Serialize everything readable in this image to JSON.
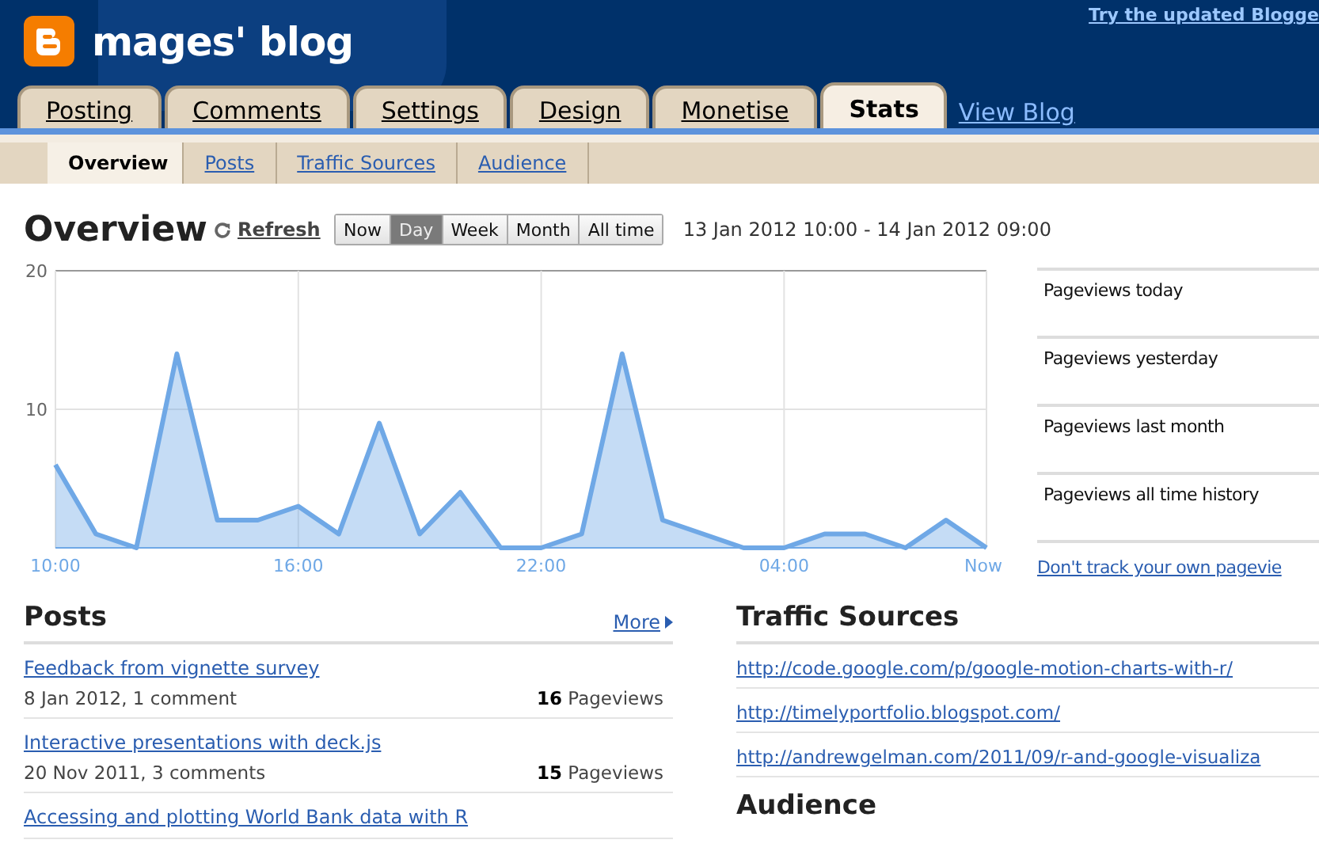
{
  "header": {
    "blog_title": "mages' blog",
    "top_link": "Try the updated Blogge"
  },
  "tabs": [
    {
      "label": "Posting",
      "selected": false
    },
    {
      "label": "Comments",
      "selected": false
    },
    {
      "label": "Settings",
      "selected": false
    },
    {
      "label": "Design",
      "selected": false
    },
    {
      "label": "Monetise",
      "selected": false
    },
    {
      "label": "Stats",
      "selected": true
    }
  ],
  "view_blog_link": "View Blog",
  "subtabs": [
    {
      "label": "Overview",
      "selected": true
    },
    {
      "label": "Posts",
      "selected": false
    },
    {
      "label": "Traffic Sources",
      "selected": false
    },
    {
      "label": "Audience",
      "selected": false
    }
  ],
  "overview": {
    "title": "Overview",
    "refresh": "Refresh",
    "ranges": [
      {
        "label": "Now",
        "selected": false
      },
      {
        "label": "Day",
        "selected": true
      },
      {
        "label": "Week",
        "selected": false
      },
      {
        "label": "Month",
        "selected": false
      },
      {
        "label": "All time",
        "selected": false
      }
    ],
    "date_range": "13 Jan 2012 10:00 - 14 Jan 2012 09:00",
    "chart_data": {
      "type": "area",
      "categories": [
        "10:00",
        null,
        null,
        null,
        null,
        null,
        "16:00",
        null,
        null,
        null,
        null,
        null,
        "22:00",
        null,
        null,
        null,
        null,
        null,
        "04:00",
        null,
        null,
        null,
        null,
        "Now"
      ],
      "series": [
        {
          "color": "#6fa8e6",
          "values": [
            6,
            1,
            0,
            14,
            2,
            2,
            3,
            1,
            9,
            1,
            4,
            0,
            0,
            1,
            14,
            2,
            1,
            0,
            0,
            1,
            1,
            0,
            2,
            0
          ]
        }
      ],
      "ylim": [
        0,
        20
      ],
      "grid": true,
      "yticks": [
        10,
        20
      ]
    }
  },
  "stats": [
    "Pageviews today",
    "Pageviews yesterday",
    "Pageviews last month",
    "Pageviews all time history"
  ],
  "dont_track_link": "Don't track your own pagevie",
  "posts": {
    "title": "Posts",
    "more": "More",
    "items": [
      {
        "title": "Feedback from vignette survey",
        "meta": "8 Jan 2012, 1 comment",
        "count": "16",
        "unit": "Pageviews"
      },
      {
        "title": "Interactive presentations with deck.js",
        "meta": "20 Nov 2011, 3 comments",
        "count": "15",
        "unit": "Pageviews"
      },
      {
        "title": "Accessing and plotting World Bank data with R"
      }
    ]
  },
  "traffic_sources": {
    "title": "Traffic Sources",
    "links": [
      "http://code.google.com/p/google-motion-charts-with-r/",
      "http://timelyportfolio.blogspot.com/",
      "http://andrewgelman.com/2011/09/r-and-google-visualiza"
    ]
  },
  "audience": {
    "title": "Audience"
  }
}
